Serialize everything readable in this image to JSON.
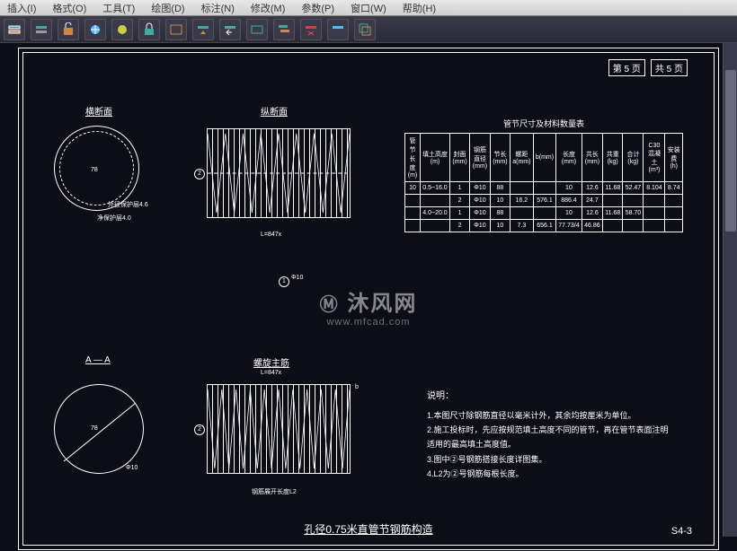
{
  "menubar": {
    "insert": "插入(I)",
    "format": "格式(O)",
    "tools": "工具(T)",
    "draw": "绘图(D)",
    "dimension": "标注(N)",
    "modify": "修改(M)",
    "parametric": "参数(P)",
    "window": "窗口(W)",
    "help": "帮助(H)"
  },
  "toolbar": {
    "icon_names": [
      "layer",
      "layer-iso",
      "layer-unlock",
      "layer-freeze",
      "layer-off",
      "layer-lock",
      "layer-state",
      "layer-match",
      "layer-prev",
      "layer-walk",
      "layer-merge",
      "layer-delete",
      "layer-vpfrz",
      "layer-copy"
    ]
  },
  "page_info": {
    "sheet": "第 5 页",
    "total": "共 5 页"
  },
  "sections": {
    "cross_section": "横断面",
    "longitudinal": "纵断面",
    "section_aa": "A — A",
    "spiral_main": "螺旋主筋"
  },
  "table": {
    "title": "管节尺寸及材料数量表",
    "headers": [
      "管节长度(m)",
      "填土高度(m)",
      "封面(mm)",
      "钢筋直径(mm)",
      "节长(mm)",
      "螺距a(mm)",
      "b(mm)",
      "长度(mm)",
      "共长(mm)",
      "共重(kg)",
      "合计(kg)",
      "C30混凝土(m³)",
      "安装费(h)"
    ],
    "rows": [
      {
        "cells": [
          "10",
          "0.5~16.0",
          "1",
          "Φ10",
          "88",
          " ",
          " ",
          "10",
          "12.6",
          "11.68",
          "52.47",
          "8.104",
          "8.74"
        ]
      },
      {
        "cells": [
          "",
          "",
          "2",
          "Φ10",
          "10",
          "16.2",
          "576.1",
          "886.4",
          "24.7",
          "",
          "",
          "",
          ""
        ]
      },
      {
        "cells": [
          "",
          "4.0~20.0",
          "1",
          "Φ10",
          "88",
          " ",
          " ",
          "10",
          "12.6",
          "11.68",
          "58.70",
          "",
          ""
        ]
      },
      {
        "cells": [
          "",
          "",
          "2",
          "Φ10",
          "10",
          "7.3",
          "656.1",
          "77.73/4",
          "46.86",
          "",
          "",
          "",
          ""
        ]
      }
    ]
  },
  "notes": {
    "title": "说明：",
    "items": [
      "1.本图尺寸除钢筋直径以毫米计外，其余均按厘米为单位。",
      "2.施工投标时，先应按规范填土高度不同的管节，再在管节表面注明",
      "  适用的最高填土高度值。",
      "3.图中②号钢筋搭接长度详图集。",
      "4.L2为②号钢筋每根长度。"
    ]
  },
  "drawing": {
    "title": "孔径0.75米直管节钢筋构造",
    "number": "S4-3"
  },
  "watermark": {
    "main": "沐风网",
    "sub": "www.mfcad.com"
  },
  "annotations": {
    "inner_protect": "净保护层4.0",
    "outer_radius": "外径保护层4.6",
    "dim_lb": "L=847x",
    "dim_b": "b"
  }
}
